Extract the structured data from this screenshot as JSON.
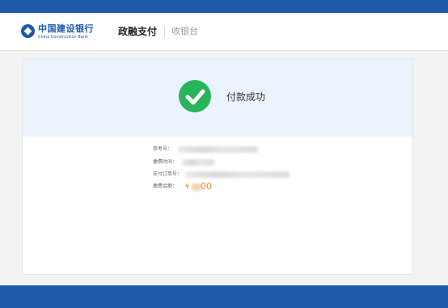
{
  "header": {
    "bank_name_cn": "中国建设银行",
    "bank_name_en": "China Construction Bank",
    "product": "政融支付",
    "section": "收银台"
  },
  "result": {
    "status_text": "付款成功",
    "icon": "check-circle-icon",
    "details": {
      "reference_label": "参考号：",
      "time_label": "缴费时间：",
      "order_label": "支付订单号：",
      "amount_label": "缴费金额：",
      "amount_currency": "¥",
      "amount_visible_suffix": "00"
    }
  },
  "colors": {
    "brand_blue": "#1d5aa8",
    "success_green": "#28b45a",
    "amount_orange": "#f08a24",
    "banner_bg": "#ebf3fc"
  }
}
